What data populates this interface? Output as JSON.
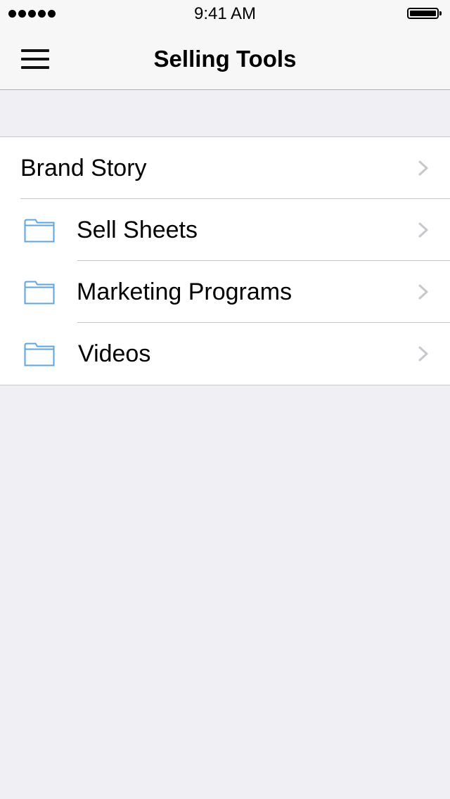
{
  "status_bar": {
    "time": "9:41 AM",
    "signal_bars": 5
  },
  "nav": {
    "title": "Selling Tools",
    "menu_icon": "hamburger-menu-icon"
  },
  "list": {
    "items": [
      {
        "label": "Brand Story",
        "icon": null
      },
      {
        "label": "Sell Sheets",
        "icon": "folder-icon"
      },
      {
        "label": "Marketing Programs",
        "icon": "folder-icon"
      },
      {
        "label": "Videos",
        "icon": "folder-icon"
      }
    ]
  },
  "colors": {
    "accent": "#5ba4e8",
    "chevron": "#c7c7cc",
    "background": "#efeff4"
  }
}
